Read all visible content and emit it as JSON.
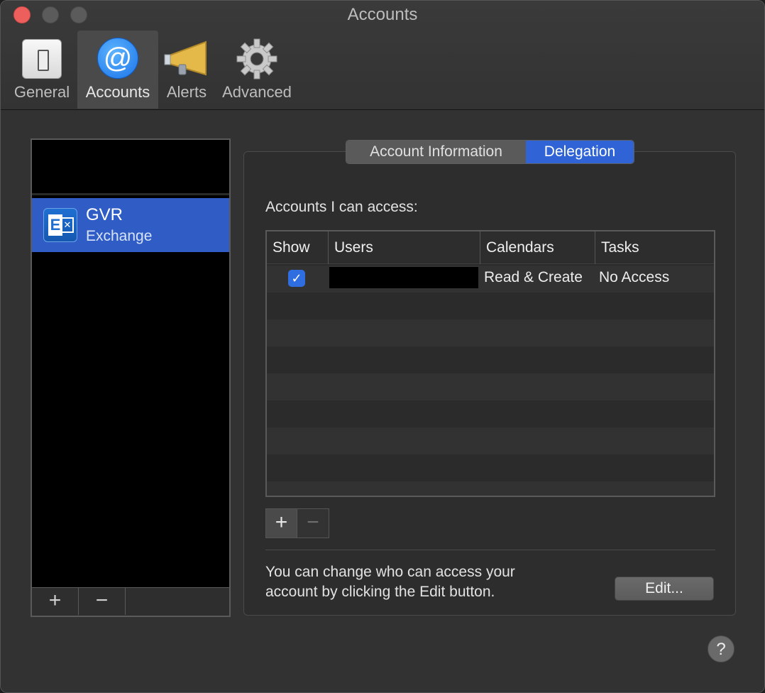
{
  "window": {
    "title": "Accounts"
  },
  "toolbar": {
    "items": [
      {
        "label": "General",
        "icon": "switch-icon",
        "selected": false
      },
      {
        "label": "Accounts",
        "icon": "at-icon",
        "selected": true
      },
      {
        "label": "Alerts",
        "icon": "megaphone-icon",
        "selected": false
      },
      {
        "label": "Advanced",
        "icon": "gear-icon",
        "selected": false
      }
    ]
  },
  "accounts": {
    "items": [
      {
        "name": "GVR",
        "type": "Exchange",
        "icon": "exchange-icon",
        "selected": true
      }
    ],
    "add_label": "+",
    "remove_label": "−"
  },
  "tabs": [
    {
      "label": "Account Information",
      "selected": false
    },
    {
      "label": "Delegation",
      "selected": true
    }
  ],
  "delegation": {
    "section_label": "Accounts I can access:",
    "columns": [
      "Show",
      "Users",
      "Calendars",
      "Tasks"
    ],
    "rows": [
      {
        "show": true,
        "user": "",
        "calendars": "Read & Create",
        "tasks": "No Access"
      }
    ],
    "add_label": "+",
    "remove_label": "−",
    "info_text": "You can change who can access your account by clicking the Edit button.",
    "edit_label": "Edit..."
  },
  "help": {
    "label": "?"
  },
  "colors": {
    "accent": "#2f63d6",
    "close": "#ec5f5d",
    "window_bg": "#323232"
  }
}
